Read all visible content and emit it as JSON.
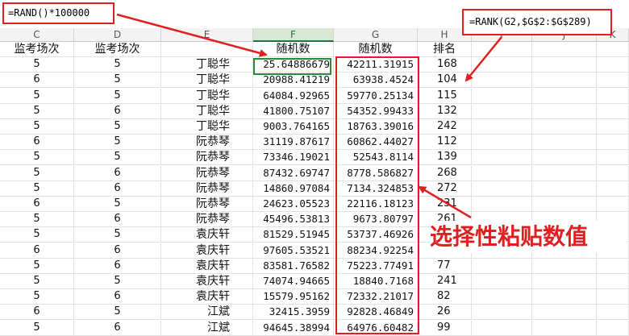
{
  "formulas": {
    "rand": "=RAND()*100000",
    "rank": "=RANK(G2,$G$2:$G$289)"
  },
  "callout_text": "选择性粘贴数值",
  "columns": [
    "C",
    "D",
    "E",
    "F",
    "G",
    "H",
    "I",
    "J",
    "K"
  ],
  "selected_column": "F",
  "header_row": {
    "c": "监考场次",
    "d": "监考场次",
    "e": "",
    "f": "随机数",
    "g": "随机数",
    "h": "排名"
  },
  "rows": [
    {
      "c": "5",
      "d": "5",
      "e": "丁聪华",
      "f": "25.64886679",
      "g": "42211.31915",
      "h": "168"
    },
    {
      "c": "6",
      "d": "5",
      "e": "丁聪华",
      "f": "20988.41219",
      "g": "63938.4524",
      "h": "104"
    },
    {
      "c": "5",
      "d": "5",
      "e": "丁聪华",
      "f": "64084.92965",
      "g": "59770.25134",
      "h": "115"
    },
    {
      "c": "5",
      "d": "6",
      "e": "丁聪华",
      "f": "41800.75107",
      "g": "54352.99433",
      "h": "132"
    },
    {
      "c": "5",
      "d": "5",
      "e": "丁聪华",
      "f": "9003.764165",
      "g": "18763.39016",
      "h": "242"
    },
    {
      "c": "6",
      "d": "5",
      "e": "阮恭琴",
      "f": "31119.87617",
      "g": "60862.44027",
      "h": "112"
    },
    {
      "c": "5",
      "d": "5",
      "e": "阮恭琴",
      "f": "73346.19021",
      "g": "52543.8114",
      "h": "139"
    },
    {
      "c": "5",
      "d": "6",
      "e": "阮恭琴",
      "f": "87432.69747",
      "g": "8778.586827",
      "h": "268"
    },
    {
      "c": "5",
      "d": "6",
      "e": "阮恭琴",
      "f": "14860.97084",
      "g": "7134.324853",
      "h": "272"
    },
    {
      "c": "6",
      "d": "5",
      "e": "阮恭琴",
      "f": "24623.05523",
      "g": "22116.18123",
      "h": "231"
    },
    {
      "c": "5",
      "d": "6",
      "e": "阮恭琴",
      "f": "45496.53813",
      "g": "9673.80797",
      "h": "261"
    },
    {
      "c": "5",
      "d": "5",
      "e": "袁庆轩",
      "f": "81529.51945",
      "g": "53737.46926",
      "h": ""
    },
    {
      "c": "6",
      "d": "6",
      "e": "袁庆轩",
      "f": "97605.53521",
      "g": "88234.92254",
      "h": "42"
    },
    {
      "c": "5",
      "d": "6",
      "e": "袁庆轩",
      "f": "83581.76582",
      "g": "75223.77491",
      "h": "77"
    },
    {
      "c": "5",
      "d": "5",
      "e": "袁庆轩",
      "f": "74074.94665",
      "g": "18840.7168",
      "h": "241"
    },
    {
      "c": "5",
      "d": "6",
      "e": "袁庆轩",
      "f": "15579.95162",
      "g": "72332.21017",
      "h": "82"
    },
    {
      "c": "6",
      "d": "5",
      "e": "江斌",
      "f": "32415.3959",
      "g": "92828.46849",
      "h": "26"
    },
    {
      "c": "5",
      "d": "6",
      "e": "江斌",
      "f": "94645.38994",
      "g": "64976.60482",
      "h": "99"
    }
  ],
  "colors": {
    "annotation": "#e02020",
    "selection": "#2a8a3c"
  }
}
